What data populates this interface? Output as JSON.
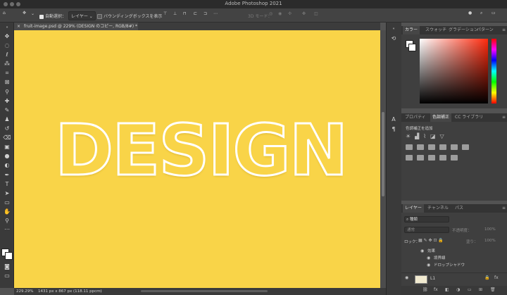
{
  "app": {
    "title": "Adobe Photoshop 2021"
  },
  "options_bar": {
    "auto_select_label": "自動選択：",
    "auto_select_target": "レイヤー",
    "bounding_box_label": "バウンディングボックスを表示",
    "three_d_mode_label": "3D モード："
  },
  "document": {
    "tab_title": "fruit-image.psd @ 229% (DESIGN のコピー, RGB/8#) *",
    "canvas_text": "DESIGN",
    "canvas_color": "#f9d448"
  },
  "status_bar": {
    "zoom": "229.29%",
    "doc_info": "1431 px x 867 px (118.11 ppcm)"
  },
  "color_panel": {
    "tabs": [
      "カラー",
      "スウォッチ",
      "グラデーション",
      "パターン"
    ],
    "active_tab": "カラー"
  },
  "adjustments_panel": {
    "tabs": [
      "プロパティ",
      "色調補正",
      "CC ライブラリ"
    ],
    "active_tab": "色調補正",
    "heading": "色調補正を追加"
  },
  "layers_panel": {
    "tabs": [
      "レイヤー",
      "チャンネル",
      "パス"
    ],
    "active_tab": "レイヤー",
    "filter_label": "種類",
    "blend_mode": "通常",
    "opacity_label": "不透明度：",
    "opacity_value": "100%",
    "lock_label": "ロック：",
    "fill_label": "塗り：",
    "fill_value": "100%",
    "effects_label": "効果",
    "effects": [
      "境界線",
      "ドロップシャドウ"
    ],
    "layer_name": "L1"
  }
}
